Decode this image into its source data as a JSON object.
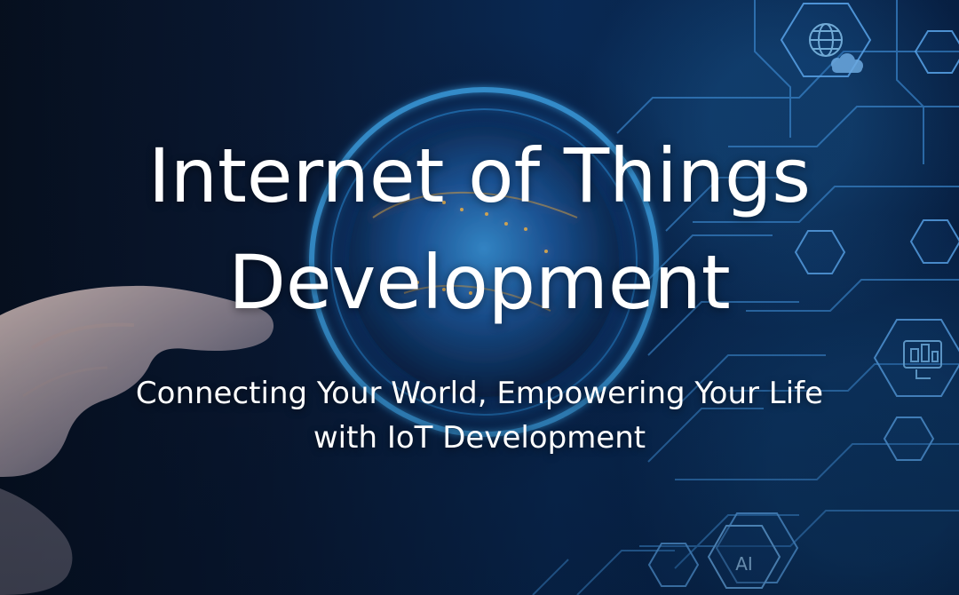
{
  "hero": {
    "title_line_1": "Internet of Things",
    "title_line_2": "Development",
    "subtitle_line_1": "Connecting Your World, Empowering Your Life",
    "subtitle_line_2": "with IoT Development",
    "badge_ai": "AI"
  },
  "colors": {
    "background": "#061633",
    "accent": "#2a8ee8",
    "text": "#ffffff"
  }
}
